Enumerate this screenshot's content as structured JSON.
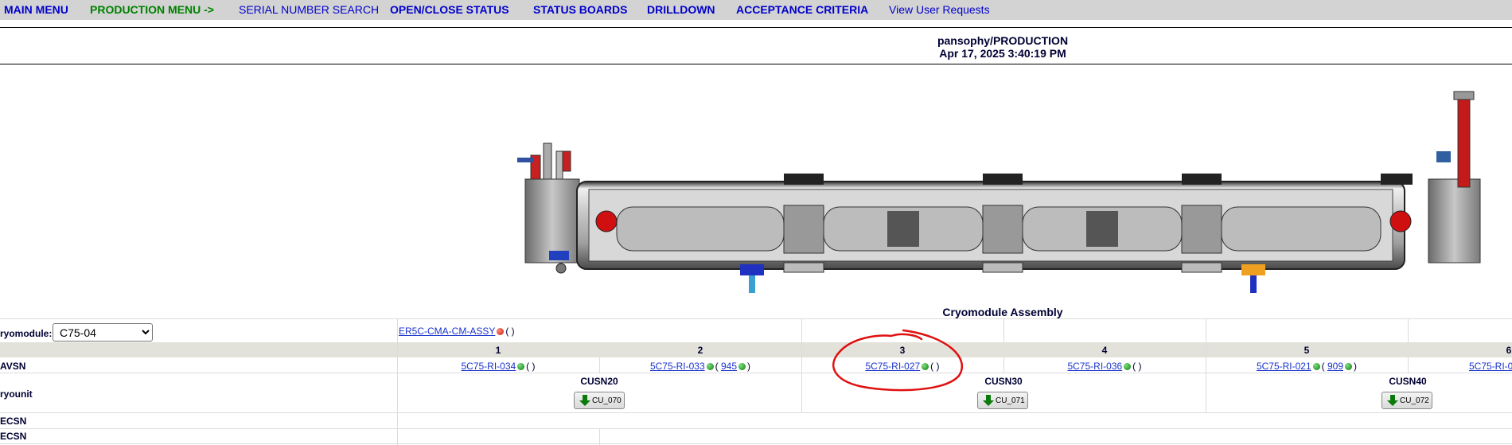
{
  "nav": {
    "main_menu": "MAIN MENU",
    "production_menu": "PRODUCTION MENU ->",
    "serial_number_search": "SERIAL NUMBER SEARCH",
    "open_close_status": "OPEN/CLOSE STATUS",
    "status_boards": "STATUS BOARDS",
    "drilldown": "DRILLDOWN",
    "acceptance_criteria": "ACCEPTANCE CRITERIA",
    "view_user_requests": "View User Requests"
  },
  "header": {
    "db": "pansophy/PRODUCTION",
    "timestamp": "Apr 17, 2025 3:40:19 PM"
  },
  "section_title": "Cryomodule Assembly",
  "cryomodule": {
    "label": "ryomodule:",
    "selected": "C75-04",
    "assembly_link": "ER5C-CMA-CM-ASSY",
    "assembly_paren": "( )"
  },
  "positions": [
    "1",
    "2",
    "3",
    "4",
    "5",
    "6"
  ],
  "avsn": {
    "label": "AVSN",
    "cells": [
      {
        "serial": "5C75-RI-034",
        "extra": "",
        "paren_open": "(",
        "paren_close": ")"
      },
      {
        "serial": "5C75-RI-033",
        "extra": "945",
        "paren_open": "(",
        "paren_close": ")"
      },
      {
        "serial": "5C75-RI-027",
        "extra": "",
        "paren_open": "(",
        "paren_close": ")"
      },
      {
        "serial": "5C75-RI-036",
        "extra": "",
        "paren_open": "(",
        "paren_close": ")"
      },
      {
        "serial": "5C75-RI-021",
        "extra": "909",
        "paren_open": "(",
        "paren_close": ")"
      },
      {
        "serial": "5C75-RI-0"
      }
    ]
  },
  "cryounit": {
    "label": "ryounit",
    "units": [
      {
        "name": "CUSN20",
        "button": "CU_070"
      },
      {
        "name": "CUSN30",
        "button": "CU_071"
      },
      {
        "name": "CUSN40",
        "button": "CU_072"
      }
    ]
  },
  "ecsn_rows": [
    "ECSN",
    "ECSN"
  ],
  "colors": {
    "nav_bg": "#d3d3d3",
    "link": "#0000cc",
    "green": "#008000",
    "annotation": "#e01010"
  }
}
